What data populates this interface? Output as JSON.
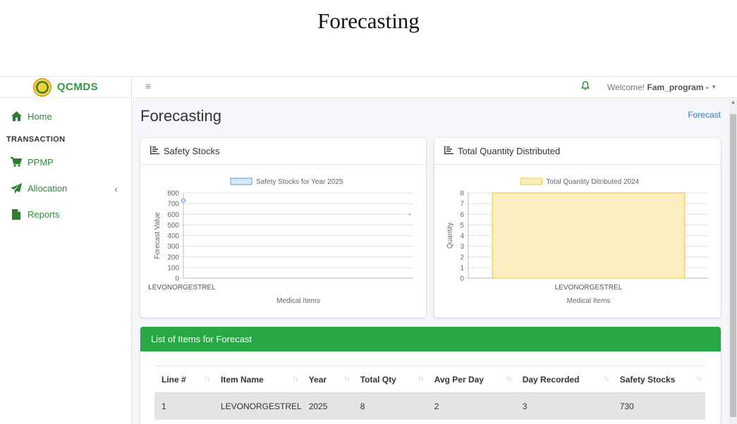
{
  "caption": "Forecasting",
  "brand": {
    "name": "QCMDS"
  },
  "sidebar": {
    "items": [
      {
        "label": "Home",
        "icon": "home-icon"
      },
      {
        "label": "PPMP",
        "icon": "cart-icon"
      },
      {
        "label": "Allocation",
        "icon": "paper-plane-icon"
      },
      {
        "label": "Reports",
        "icon": "file-icon"
      }
    ],
    "section": "TRANSACTION"
  },
  "topbar": {
    "menu_icon": "≡",
    "welcome_prefix": "Welcome!",
    "user": "Fam_program -"
  },
  "page": {
    "title": "Forecasting",
    "breadcrumb": "Forecast"
  },
  "cards": {
    "safety": {
      "title": "Safety Stocks"
    },
    "distributed": {
      "title": "Total Quantity Distributed"
    }
  },
  "chart_data": [
    {
      "type": "line",
      "legend": "Safety Stocks for Year 2025",
      "categories": [
        "LEVONORGESTREL"
      ],
      "series": [
        {
          "name": "Safety Stocks for Year 2025",
          "values": [
            730
          ]
        }
      ],
      "xlabel": "Medical Items",
      "ylabel": "Forecast Value",
      "ylim": [
        0,
        800
      ],
      "yticks": [
        0,
        100,
        200,
        300,
        400,
        500,
        600,
        700,
        800
      ],
      "color": "#5b9bd5",
      "grid": true,
      "legend_position": "top"
    },
    {
      "type": "bar",
      "legend": "Total Quantity Ditributed 2024",
      "categories": [
        "LEVONORGESTREL"
      ],
      "series": [
        {
          "name": "Total Quantity Ditributed 2024",
          "values": [
            8
          ]
        }
      ],
      "xlabel": "Medical Items",
      "ylabel": "Quantity",
      "ylim": [
        0,
        8
      ],
      "yticks": [
        0,
        1,
        2,
        3,
        4,
        5,
        6,
        7,
        8
      ],
      "color": "#f2c94c",
      "fill": "#fdeebf",
      "grid": true,
      "legend_position": "top"
    }
  ],
  "table": {
    "title": "List of Items for Forecast",
    "columns": [
      "Line #",
      "Item Name",
      "Year",
      "Total Qty",
      "Avg Per Day",
      "Day Recorded",
      "Safety Stocks"
    ],
    "rows": [
      [
        "1",
        "LEVONORGESTREL",
        "2025",
        "8",
        "2",
        "3",
        "730"
      ]
    ]
  },
  "colors": {
    "accent_green": "#28a745",
    "brand_green": "#2f9b3e",
    "link_blue": "#2f7ac5"
  }
}
